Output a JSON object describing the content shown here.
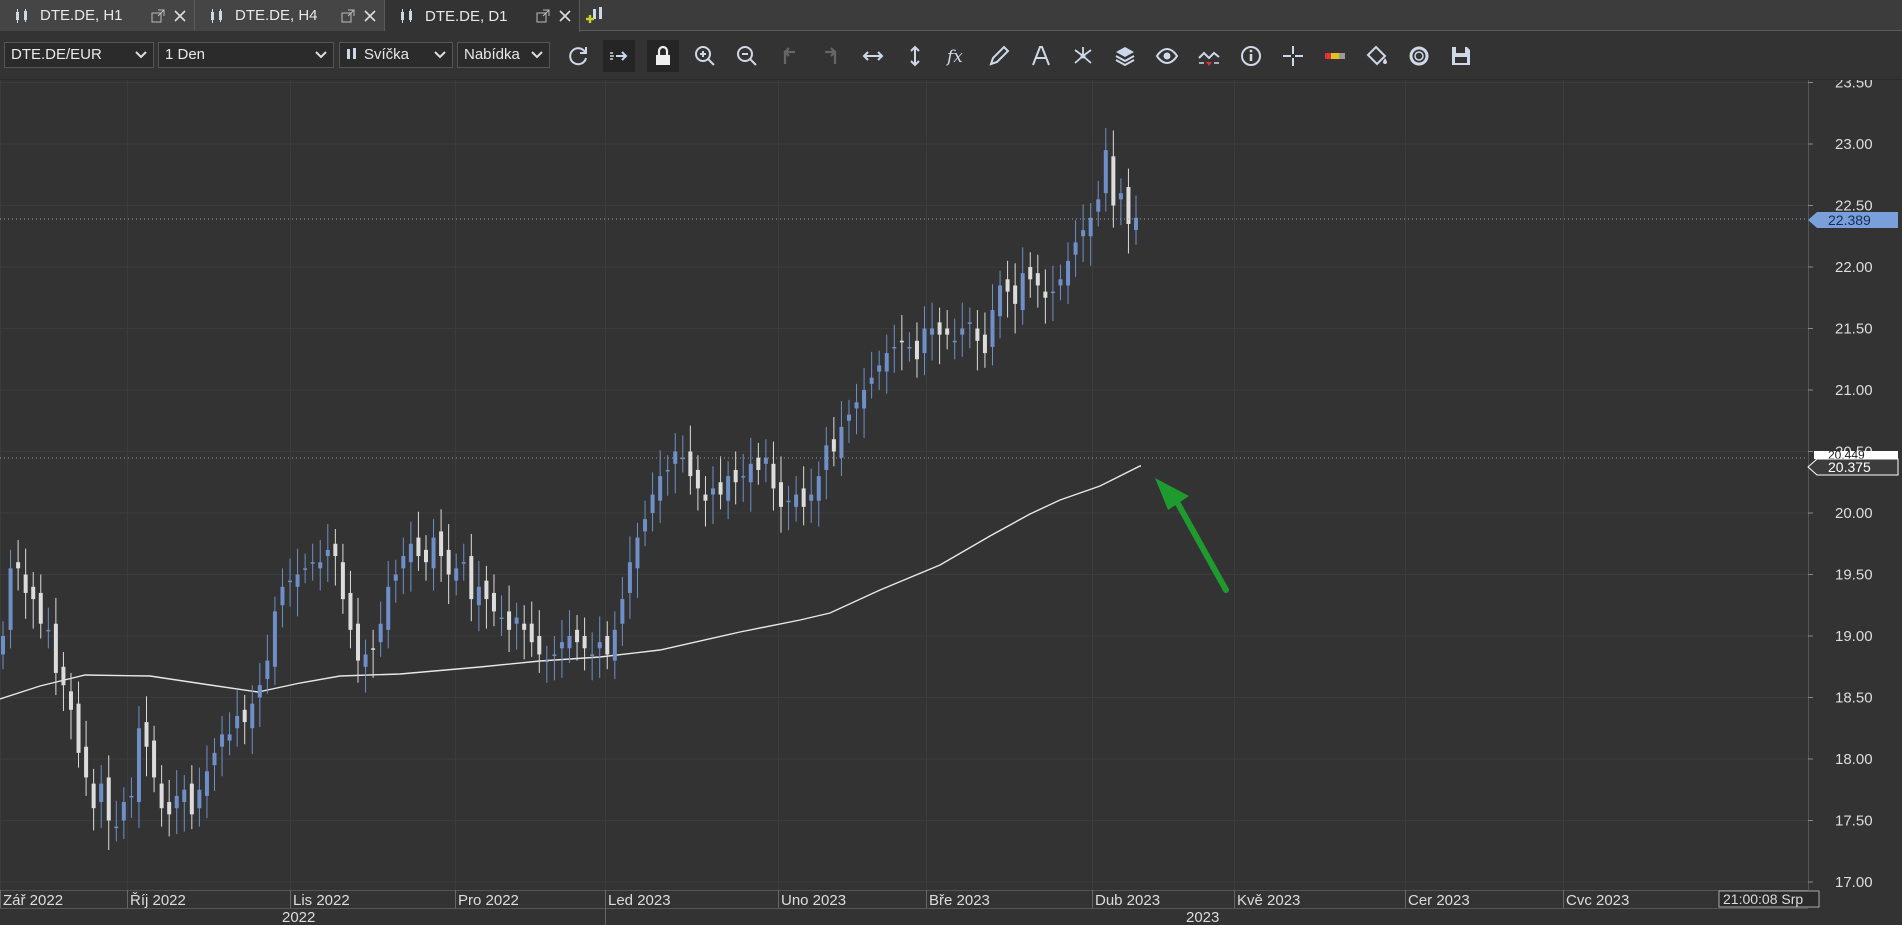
{
  "tabs": [
    {
      "label": "DTE.DE, H1",
      "active": false
    },
    {
      "label": "DTE.DE, H4",
      "active": false
    },
    {
      "label": "DTE.DE, D1",
      "active": true
    }
  ],
  "toolbar": {
    "instrument": "DTE.DE/EUR",
    "period": "1 Den",
    "chart_type": "Svíčka",
    "offer_side": "Nabídka",
    "icons": [
      "refresh-icon",
      "shift-chart-icon",
      "lock-icon",
      "zoom-in-icon",
      "zoom-out-icon",
      "undo-icon",
      "redo-icon",
      "horizontal-scale-icon",
      "vertical-scale-icon",
      "indicator-fx-icon",
      "pencil-icon",
      "text-tool-icon",
      "pattern-icon",
      "layers-icon",
      "eye-icon",
      "signal-icon",
      "info-icon",
      "crosshair-icon",
      "data-bar-icon",
      "theme-paint-icon",
      "cycle-icon",
      "save-icon"
    ]
  },
  "colors": {
    "background": "#333333",
    "bull_candle": "#6f8fc8",
    "bear_candle": "#dcdcdc",
    "ma_line": "#e8e8e8",
    "arrow": "#1e9a2e",
    "price_tag": "#7aa0dc"
  },
  "chart_data": {
    "type": "candlestick",
    "instrument": "DTE.DE/EUR",
    "timeframe": "1 Den",
    "y_axis": {
      "min": 17.0,
      "max": 23.5,
      "ticks": [
        "17.00",
        "17.50",
        "18.00",
        "18.50",
        "19.00",
        "19.50",
        "20.00",
        "20.50",
        "21.00",
        "21.50",
        "22.00",
        "22.50",
        "23.00",
        "23.50"
      ]
    },
    "x_labels": [
      "Zář 2022",
      "Říj 2022",
      "Lis 2022",
      "Pro 2022",
      "Led 2023",
      "Uno 2023",
      "Bře 2023",
      "Dub 2023",
      "Kvě 2023",
      "Cer 2023",
      "Cvc 2023"
    ],
    "year_labels": [
      "2022",
      "2023"
    ],
    "time_label": "21:00:08 Srp",
    "last_price": "22.389",
    "ma_label_top": "20.449",
    "ma_label_bottom": "20.375",
    "close_prices": [
      19.0,
      19.55,
      19.55,
      19.35,
      19.3,
      19.1,
      19.05,
      18.7,
      18.6,
      18.4,
      18.05,
      17.85,
      17.6,
      17.8,
      17.5,
      17.45,
      17.65,
      17.7,
      18.25,
      18.1,
      17.85,
      17.6,
      17.55,
      17.7,
      17.75,
      17.55,
      17.75,
      17.9,
      18.05,
      18.2,
      18.2,
      18.35,
      18.3,
      18.45,
      18.6,
      18.8,
      19.2,
      19.4,
      19.45,
      19.5,
      19.55,
      19.6,
      19.6,
      19.7,
      19.65,
      19.3,
      19.05,
      18.8,
      18.85,
      18.9,
      19.1,
      19.4,
      19.5,
      19.65,
      19.75,
      19.65,
      19.6,
      19.8,
      19.65,
      19.5,
      19.55,
      19.6,
      19.3,
      19.4,
      19.3,
      19.2,
      19.15,
      19.05,
      19.15,
      19.05,
      18.95,
      18.85,
      18.8,
      18.85,
      18.95,
      19.0,
      18.95,
      18.9,
      18.85,
      18.95,
      18.85,
      19.05,
      19.3,
      19.6,
      19.8,
      19.95,
      20.15,
      20.3,
      20.35,
      20.5,
      20.45,
      20.3,
      20.2,
      20.1,
      20.2,
      20.15,
      20.3,
      20.25,
      20.3,
      20.4,
      20.35,
      20.45,
      20.2,
      20.05,
      20.1,
      20.15,
      20.05,
      20.15,
      20.3,
      20.55,
      20.5,
      20.7,
      20.8,
      20.9,
      21.0,
      21.1,
      21.2,
      21.3,
      21.35,
      21.4,
      21.35,
      21.25,
      21.5,
      21.5,
      21.45,
      21.45,
      21.4,
      21.5,
      21.55,
      21.4,
      21.3,
      21.65,
      21.85,
      21.8,
      21.7,
      21.95,
      21.9,
      21.85,
      21.75,
      21.8,
      21.9,
      22.05,
      22.2,
      22.3,
      22.4,
      22.55,
      22.95,
      22.5,
      22.6,
      22.35,
      22.4
    ],
    "ma_values": {
      "start": 18.5,
      "end": 20.45
    }
  }
}
